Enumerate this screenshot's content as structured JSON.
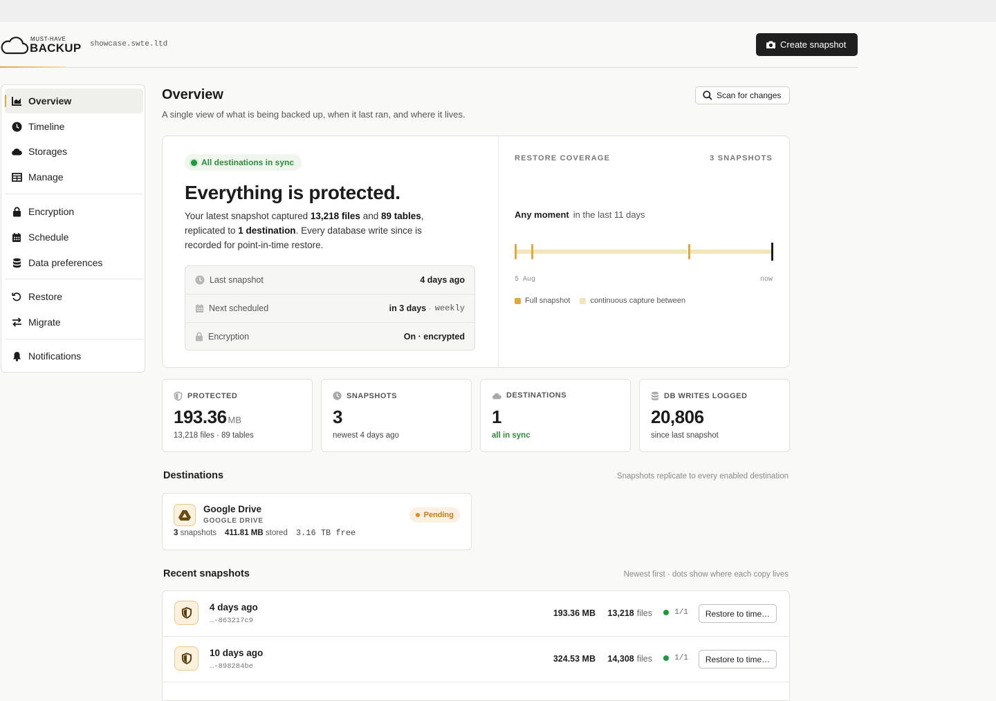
{
  "header": {
    "logo_small": "MUST-HAVE",
    "logo_big": "BACKUP",
    "domain": "showcase.swte.ltd",
    "create_label": "Create snapshot"
  },
  "sidebar": {
    "items": [
      {
        "label": "Overview",
        "icon": "chart-icon",
        "active": true
      },
      {
        "label": "Timeline",
        "icon": "clock-icon"
      },
      {
        "label": "Storages",
        "icon": "cloud-icon"
      },
      {
        "label": "Manage",
        "icon": "table-icon"
      },
      {
        "label": "Encryption",
        "icon": "lock-icon"
      },
      {
        "label": "Schedule",
        "icon": "calendar-icon"
      },
      {
        "label": "Data preferences",
        "icon": "database-icon"
      },
      {
        "label": "Restore",
        "icon": "restore-icon"
      },
      {
        "label": "Migrate",
        "icon": "swap-icon"
      },
      {
        "label": "Notifications",
        "icon": "bell-icon"
      }
    ]
  },
  "page": {
    "title": "Overview",
    "subtitle": "A single view of what is being backed up, when it last ran, and where it lives.",
    "scan_label": "Scan for changes"
  },
  "hero": {
    "pill": "All destinations in sync",
    "title": "Everything is protected.",
    "text": {
      "p1": "Your latest snapshot captured ",
      "files": "13,218 files",
      "p2": " and ",
      "tables": "89 tables",
      "p3": ", replicated to ",
      "dest": "1 destination",
      "p4": ". Every database write since is recorded for point-in-time restore."
    },
    "rows": [
      {
        "label": "Last snapshot",
        "value": "4 days ago",
        "icon": "clock-icon"
      },
      {
        "label": "Next scheduled",
        "value": "in 3 days",
        "sep": " · ",
        "extra": "weekly",
        "icon": "calendar-icon"
      },
      {
        "label": "Encryption",
        "value": "On · encrypted",
        "icon": "lock-icon"
      }
    ],
    "coverage_label": "RESTORE COVERAGE",
    "coverage_count": "3 SNAPSHOTS",
    "moment_strong": "Any moment",
    "moment_rest": "in the last 11 days",
    "timeline_start": "5 Aug",
    "timeline_end": "now",
    "legend_full": "Full snapshot",
    "legend_cont": "continuous capture between",
    "accent": "#e3a73a",
    "capture_color": "#f3e4bc"
  },
  "stats": [
    {
      "label": "PROTECTED",
      "value": "193.36",
      "unit": "MB",
      "sub": "13,218 files · 89 tables",
      "icon": "shield-icon"
    },
    {
      "label": "SNAPSHOTS",
      "value": "3",
      "sub": "newest 4 days ago",
      "icon": "clock-icon"
    },
    {
      "label": "DESTINATIONS",
      "value": "1",
      "sub": "all in sync",
      "icon": "cloud-icon"
    },
    {
      "label": "DB WRITES LOGGED",
      "value": "20,806",
      "sub": "since last snapshot",
      "icon": "database-icon"
    }
  ],
  "destinations": {
    "title": "Destinations",
    "note": "Snapshots replicate to every enabled destination",
    "items": [
      {
        "name": "Google Drive",
        "type": "GOOGLE DRIVE",
        "status": "Pending",
        "count": "3",
        "count_label": "snapshots",
        "stored": "411.81 MB",
        "stored_label": "stored",
        "free": "3.16 TB free",
        "icon": "google-drive-icon"
      }
    ]
  },
  "snapshots": {
    "title": "Recent snapshots",
    "note": "Newest first · dots show where each copy lives",
    "items": [
      {
        "title": "4 days ago",
        "id": "…-863217c9",
        "size": "193.36 MB",
        "files": "13,218",
        "files_label": "files",
        "copies": "1/1",
        "restore": "Restore to time…"
      },
      {
        "title": "10 days ago",
        "id": "…-898284be",
        "size": "324.53 MB",
        "files": "14,308",
        "files_label": "files",
        "copies": "1/1",
        "restore": "Restore to time…"
      }
    ]
  }
}
